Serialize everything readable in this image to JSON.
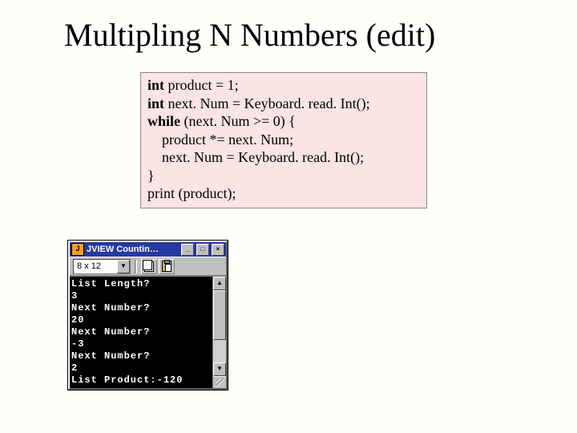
{
  "title": "Multipling N Numbers (edit)",
  "code": {
    "l1_kw": "int",
    "l1_rest": " product = 1;",
    "l2_kw": "int",
    "l2_rest": " next. Num = Keyboard. read. Int();",
    "l3_kw": "while",
    "l3_rest": " (next. Num >= 0) {",
    "l4": "product *= next. Num;",
    "l5": "next. Num = Keyboard. read. Int();",
    "l6": "}",
    "l7": "print (product);"
  },
  "window": {
    "app_icon_letter": "J",
    "title": "JVIEW Countin…",
    "min": "_",
    "max": "□",
    "close": "×",
    "font_select": "8 x 12",
    "dropdown_arrow": "▼",
    "scroll_up": "▲",
    "scroll_down": "▼"
  },
  "console_lines": [
    "List Length?",
    "3",
    "Next Number?",
    "20",
    "Next Number?",
    "-3",
    "Next Number?",
    "2",
    "List Product:-120"
  ]
}
